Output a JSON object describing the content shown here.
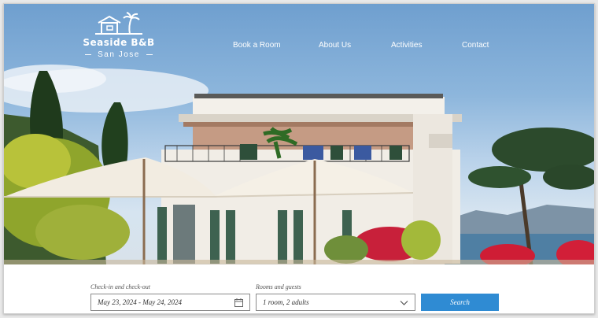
{
  "brand": {
    "name": "Seaside B&B",
    "location": "San Jose"
  },
  "nav": [
    {
      "label": "Book a Room"
    },
    {
      "label": "About Us"
    },
    {
      "label": "Activities"
    },
    {
      "label": "Contact"
    }
  ],
  "booking": {
    "dates_label": "Check-in and check-out",
    "dates_value": "May 23, 2024 - May 24, 2024",
    "guests_label": "Rooms and guests",
    "guests_value": "1 room, 2 adults",
    "search_label": "Search"
  },
  "colors": {
    "accent": "#2f8bd3"
  },
  "icons": [
    "house-palm-logo-icon",
    "calendar-icon",
    "chevron-down-icon"
  ]
}
